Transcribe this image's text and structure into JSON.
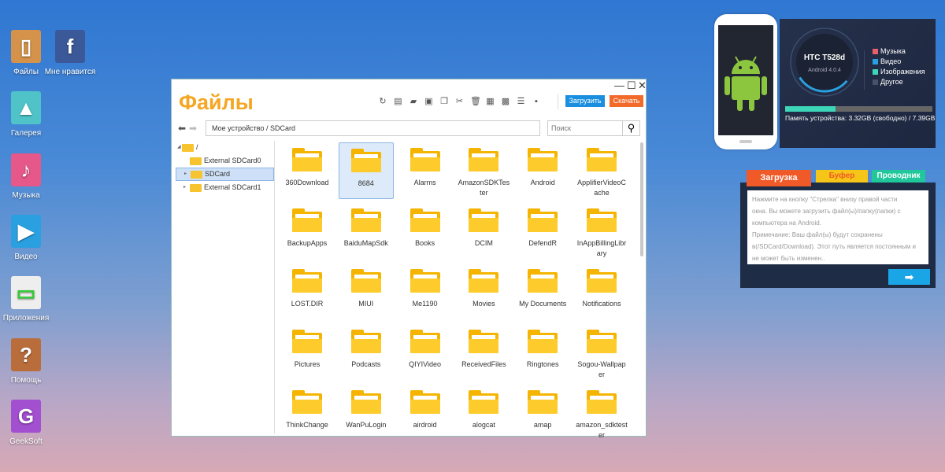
{
  "desktop": [
    {
      "label": "Файлы",
      "icon": "archive-box-icon",
      "color": "#d4924a",
      "glyph": "▯"
    },
    {
      "label": "Мне нравится",
      "icon": "facebook-icon",
      "color": "#3b5998",
      "glyph": "f"
    },
    {
      "label": "Галерея",
      "icon": "gallery-icon",
      "color": "#4fc3c8",
      "glyph": "▲"
    },
    {
      "label": "Музыка",
      "icon": "music-icon",
      "color": "#e6578a",
      "glyph": "♪"
    },
    {
      "label": "Видео",
      "icon": "video-icon",
      "color": "#2aa0e0",
      "glyph": "▶"
    },
    {
      "label": "Приложения",
      "icon": "apps-bag-icon",
      "color": "#eeeeee",
      "glyph": "▭"
    },
    {
      "label": "Помощь",
      "icon": "help-icon",
      "color": "#b86d3b",
      "glyph": "?"
    },
    {
      "label": "GeekSoft",
      "icon": "geeksoft-logo-icon",
      "color": "#a24fd0",
      "glyph": "G"
    }
  ],
  "window": {
    "title": "Файлы",
    "controls": {
      "minimize": "—",
      "maximize": "☐",
      "close": "✕"
    },
    "toolbar": [
      {
        "name": "refresh-icon",
        "glyph": "↻"
      },
      {
        "name": "new-folder-icon",
        "glyph": "▤"
      },
      {
        "name": "open-folder-icon",
        "glyph": "▰"
      },
      {
        "name": "rename-icon",
        "glyph": "▣"
      },
      {
        "name": "copy-icon",
        "glyph": "❐"
      },
      {
        "name": "cut-icon",
        "glyph": "✂"
      },
      {
        "name": "delete-icon",
        "glyph": "🗑"
      },
      {
        "name": "select-all-icon",
        "glyph": "▦"
      },
      {
        "name": "select-check-icon",
        "glyph": "▩"
      },
      {
        "name": "list-view-icon",
        "glyph": "☰"
      },
      {
        "name": "grid-view-icon",
        "glyph": "▪"
      }
    ],
    "upload_label": "Загрузить",
    "download_label": "Скачать",
    "upload_color": "#1a8fe0",
    "download_color": "#f26b2a",
    "breadcrumb": "Мое устройство   /   SDCard",
    "search_placeholder": "Поиск",
    "tree": [
      {
        "label": "/",
        "level": 0,
        "expanded": true
      },
      {
        "label": "External SDCard0",
        "level": 1
      },
      {
        "label": "SDCard",
        "level": 1,
        "selected": true
      },
      {
        "label": "External SDCard1",
        "level": 1
      }
    ],
    "folders": [
      "360Download",
      "8684",
      "Alarms",
      "AmazonSDKTester",
      "Android",
      "ApplifierVideoCache",
      "BackupApps",
      "BaiduMapSdk",
      "Books",
      "DCIM",
      "DefendR",
      "InAppBillingLibrary",
      "LOST.DIR",
      "MIUI",
      "Me1190",
      "Movies",
      "My Documents",
      "Notifications",
      "Pictures",
      "Podcasts",
      "QIYIVideo",
      "ReceivedFiles",
      "Ringtones",
      "Sogou-Wallpaper",
      "ThinkChange",
      "WanPuLogin",
      "airdroid",
      "alogcat",
      "amap",
      "amazon_sdktester"
    ],
    "selected_folder": "8684"
  },
  "device": {
    "model": "HTC T528d",
    "os": "Android 4.0.4",
    "legend": [
      {
        "label": "Музыка",
        "color": "#e8606a"
      },
      {
        "label": "Видео",
        "color": "#2aa0e0"
      },
      {
        "label": "Изображения",
        "color": "#3dd6b8"
      },
      {
        "label": "Другое",
        "color": "#4a5068"
      }
    ],
    "memory_text": "Память устройства: 3.32GB (свободно) / 7.39GB",
    "used_fraction": 0.34
  },
  "transfer": {
    "tabs": [
      {
        "label": "Загрузка",
        "color": "#f05a28"
      },
      {
        "label": "Буфер обмена",
        "color": "#f5c518"
      },
      {
        "label": "Проводник",
        "color": "#1fc79a"
      }
    ],
    "text_lines": [
      "Нажмите на кнопку \"Стрелка\" внизу правой части",
      "окна. Вы можете загрузить файл(ы)/папку(папки) с",
      "компьютера на Android.",
      "Примечание: Ваш файл(ы) будут сохранены",
      "в(/SDCard/Download). Этот путь является постоянным и",
      "не может быть изменен.."
    ],
    "arrow": "➡"
  }
}
